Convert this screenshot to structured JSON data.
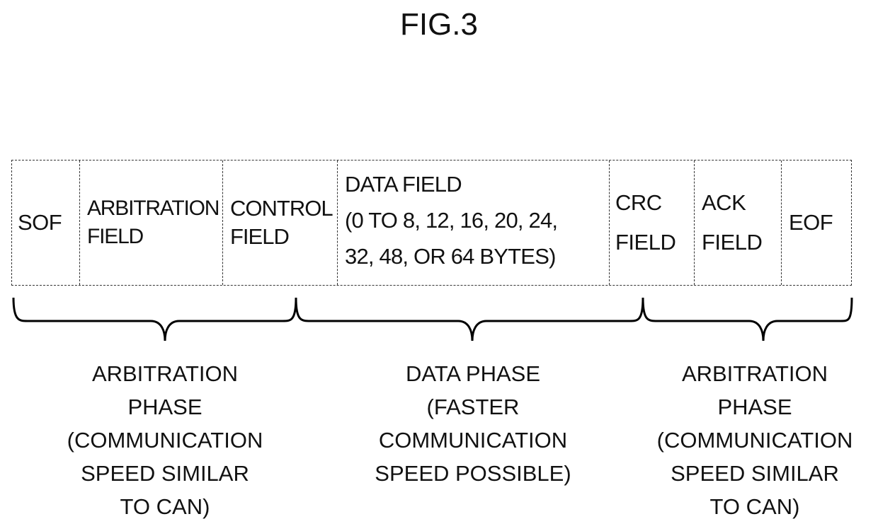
{
  "title": "FIG.3",
  "fields": [
    {
      "id": "sof",
      "label": "SOF"
    },
    {
      "id": "arbitration",
      "label": "ARBITRATION\nFIELD"
    },
    {
      "id": "control",
      "label": "CONTROL\nFIELD"
    },
    {
      "id": "data",
      "label": "DATA FIELD\n(0 TO 8, 12, 16, 20, 24,\n32, 48, OR 64 BYTES)"
    },
    {
      "id": "crc",
      "label": "CRC\nFIELD"
    },
    {
      "id": "ack",
      "label": "ACK\nFIELD"
    },
    {
      "id": "eof",
      "label": "EOF"
    }
  ],
  "phases": [
    {
      "id": "arbitration-phase-1",
      "label": "ARBITRATION\nPHASE\n(COMMUNICATION\nSPEED SIMILAR\nTO CAN)"
    },
    {
      "id": "data-phase",
      "label": "DATA PHASE\n(FASTER\nCOMMUNICATION\nSPEED POSSIBLE)"
    },
    {
      "id": "arbitration-phase-2",
      "label": "ARBITRATION\nPHASE\n(COMMUNICATION\nSPEED SIMILAR\nTO CAN)"
    }
  ]
}
